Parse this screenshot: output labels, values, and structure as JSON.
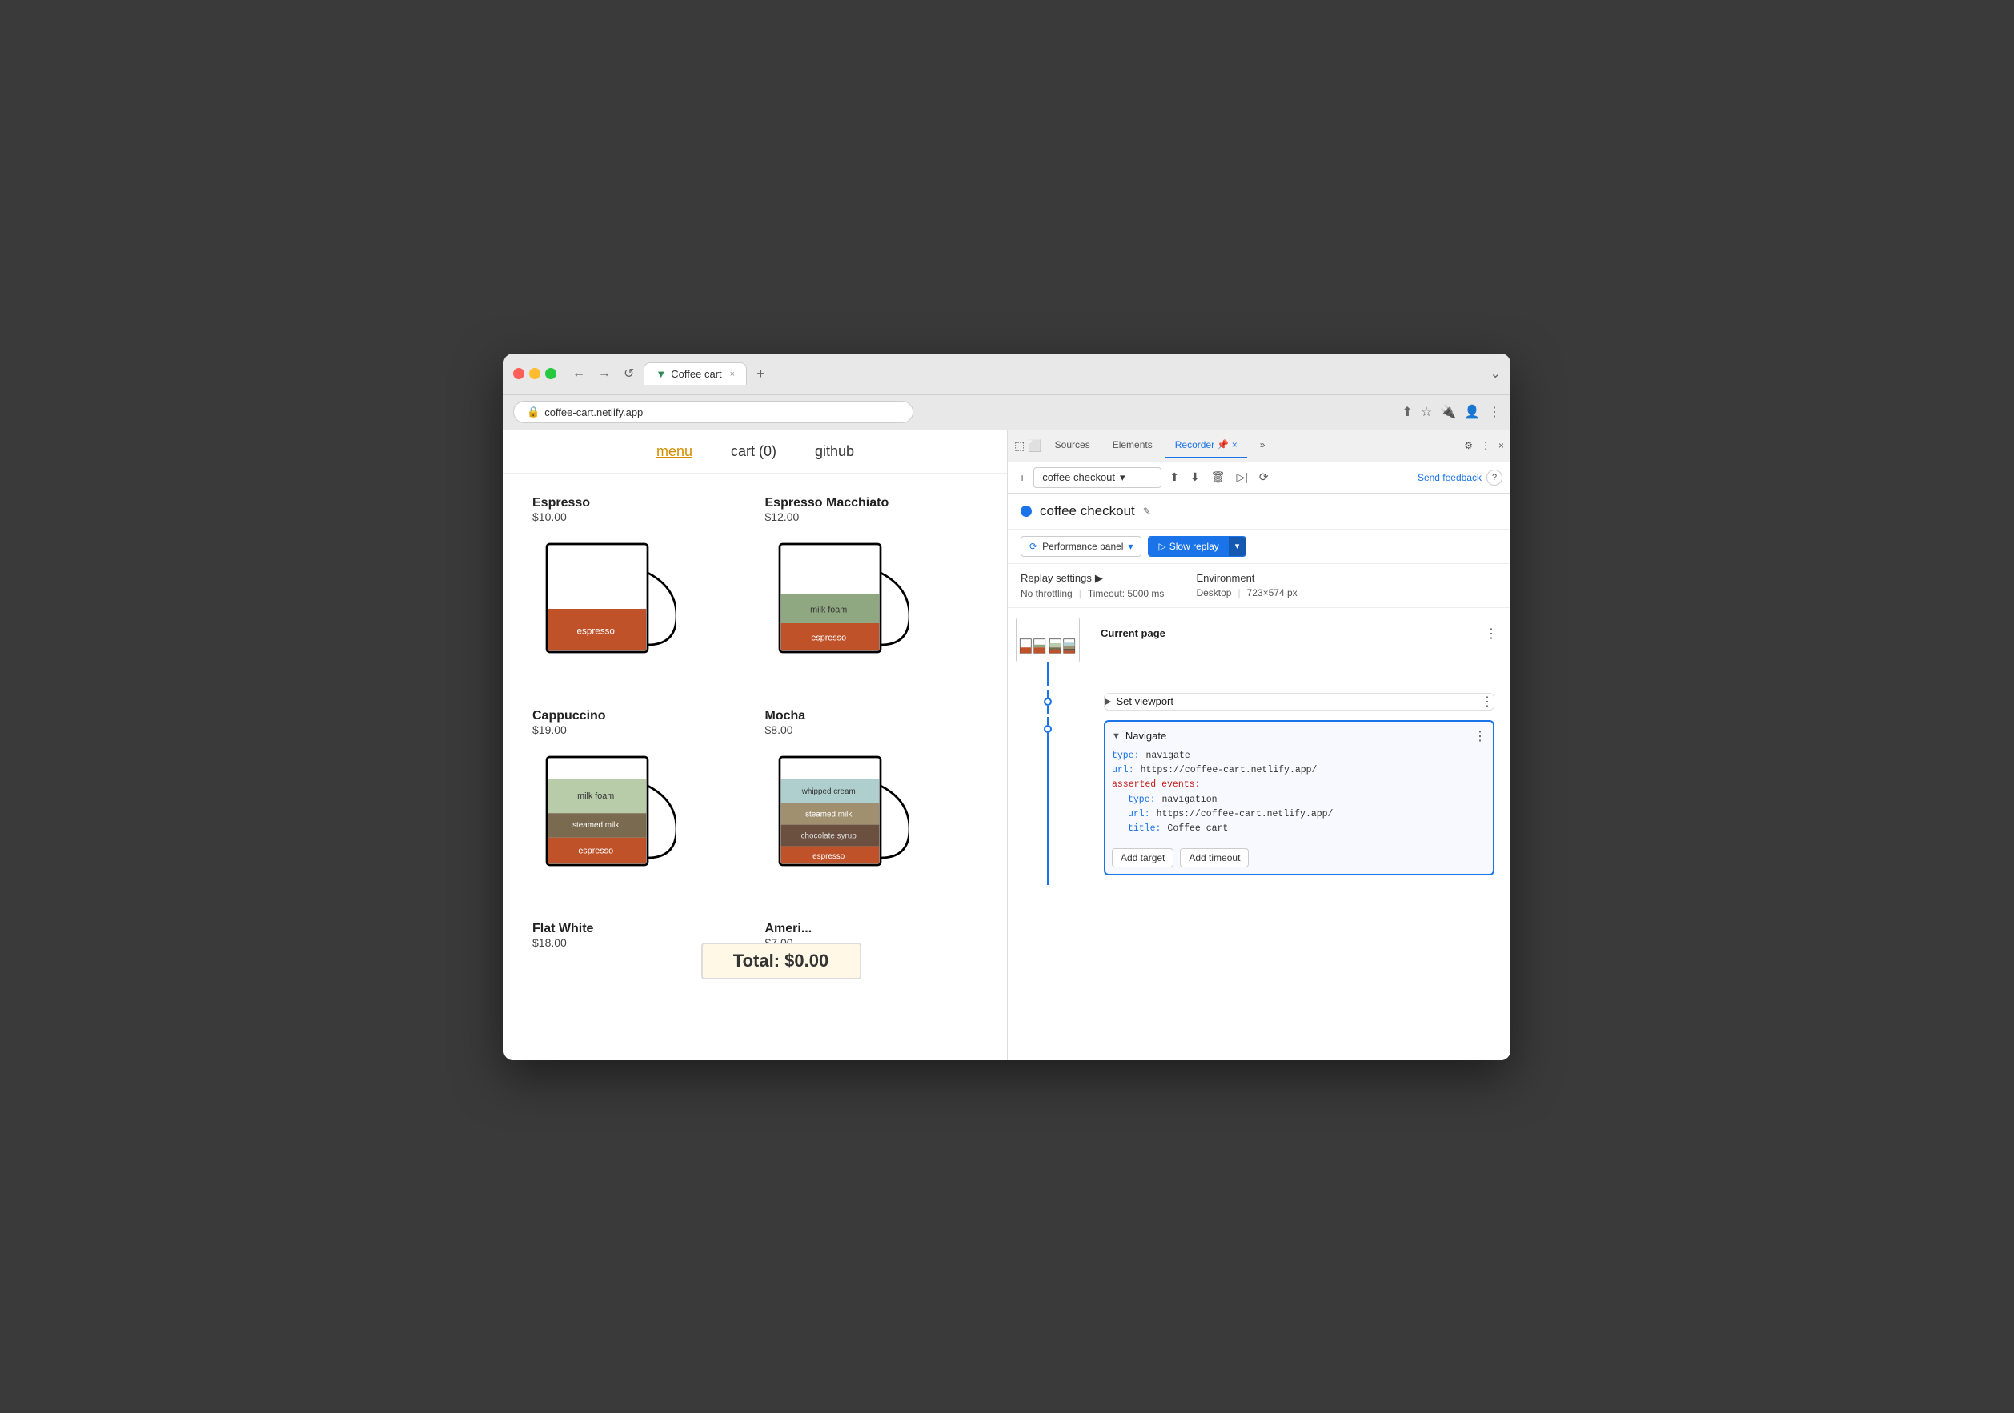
{
  "browser": {
    "url": "coffee-cart.netlify.app",
    "tab_title": "Coffee cart",
    "tab_favicon": "▼",
    "new_tab": "+",
    "chevron": "⌄",
    "back": "←",
    "forward": "→",
    "refresh": "↺"
  },
  "devtools": {
    "tabs": [
      "Sources",
      "Elements",
      "Recorder",
      "»"
    ],
    "active_tab": "Recorder",
    "pin_icon": "📌",
    "close_icon": "×",
    "settings_icon": "⚙",
    "more_icon": "⋮",
    "recording_name": "coffee checkout",
    "recording_name_toolbar": "coffee checkout",
    "send_feedback": "Send feedback",
    "add_btn": "+",
    "export_icon": "⬆",
    "import_icon": "⬇",
    "delete_icon": "🗑",
    "play_icon": "▷",
    "wand_icon": "⟳",
    "edit_icon": "✎",
    "perf_panel_label": "Performance panel",
    "slow_replay_label": "Slow replay",
    "replay_settings_label": "Replay settings",
    "replay_settings_arrow": "▶",
    "throttling_label": "No throttling",
    "timeout_label": "Timeout: 5000 ms",
    "environment_label": "Environment",
    "desktop_label": "Desktop",
    "resolution_label": "723×574 px",
    "current_page_label": "Current page",
    "step1_name": "Set viewport",
    "step2_name": "Navigate",
    "code_type": "type:",
    "code_type_val": "navigate",
    "code_url": "url:",
    "code_url_val": "https://coffee-cart.netlify.app/",
    "code_asserted": "asserted events:",
    "code_nav_type": "type:",
    "code_nav_type_val": "navigation",
    "code_nav_url": "url:",
    "code_nav_url_val": "https://coffee-cart.netlify.app/",
    "code_nav_title": "title:",
    "code_nav_title_val": "Coffee cart",
    "add_target_btn": "Add target",
    "add_timeout_btn": "Add timeout"
  },
  "website": {
    "nav_menu": "menu",
    "nav_cart": "cart (0)",
    "nav_github": "github",
    "coffees": [
      {
        "name": "Espresso",
        "price": "$10.00",
        "layers": [
          {
            "label": "espresso",
            "color": "#c0522a",
            "height": 80
          }
        ]
      },
      {
        "name": "Espresso Macchiato",
        "price": "$12.00",
        "layers": [
          {
            "label": "milk foam",
            "color": "#8fa882",
            "height": 40
          },
          {
            "label": "espresso",
            "color": "#c0522a",
            "height": 80
          }
        ]
      },
      {
        "name": "Cappuccino",
        "price": "$19.00",
        "layers": [
          {
            "label": "milk foam",
            "color": "#b8ccaa",
            "height": 60
          },
          {
            "label": "steamed milk",
            "color": "#7a6a50",
            "height": 50
          },
          {
            "label": "espresso",
            "color": "#c0522a",
            "height": 50
          }
        ]
      },
      {
        "name": "Mocha",
        "price": "$8.00",
        "layers": [
          {
            "label": "whipped cream",
            "color": "#aecfce",
            "height": 40
          },
          {
            "label": "steamed milk",
            "color": "#a09070",
            "height": 40
          },
          {
            "label": "chocolate syrup",
            "color": "#6b5040",
            "height": 40
          },
          {
            "label": "espresso",
            "color": "#c0522a",
            "height": 40
          }
        ]
      }
    ],
    "flat_white": {
      "name": "Flat White",
      "price": "$18.00"
    },
    "americano": {
      "name": "Ameri...",
      "price": "$7.00"
    },
    "total": "Total: $0.00"
  }
}
